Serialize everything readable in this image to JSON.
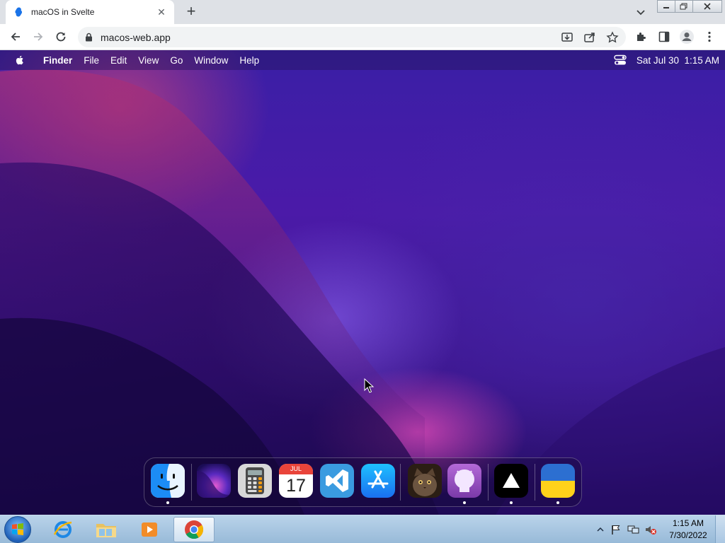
{
  "browser": {
    "tab_title": "macOS in Svelte",
    "tab_close": "✕",
    "new_tab": "+",
    "url": "macos-web.app"
  },
  "menubar": {
    "app_name": "Finder",
    "items": [
      "File",
      "Edit",
      "View",
      "Go",
      "Window",
      "Help"
    ],
    "datetime": "Sat Jul 30  1:15 AM"
  },
  "dock": {
    "apps": [
      {
        "name": "finder-dock-icon",
        "running": true
      },
      {
        "name": "wallpapers-dock-icon",
        "running": false
      },
      {
        "name": "calculator-dock-icon",
        "running": false
      },
      {
        "name": "calendar-dock-icon",
        "running": false,
        "month": "JUL",
        "day": "17"
      },
      {
        "name": "vscode-dock-icon",
        "running": false
      },
      {
        "name": "app-store-dock-icon",
        "running": false
      },
      {
        "name": "cat-dock-icon",
        "running": false
      },
      {
        "name": "github-dock-icon",
        "running": true
      },
      {
        "name": "vercel-dock-icon",
        "running": true
      },
      {
        "name": "ukraine-flag-dock-icon",
        "running": true
      }
    ]
  },
  "taskbar": {
    "time": "1:15 AM",
    "date": "7/30/2022"
  },
  "colors": {
    "accent_purple": "#4b1aa8",
    "chrome_tabstrip": "#dee1e6",
    "taskbar_blue": "#98bad8"
  }
}
